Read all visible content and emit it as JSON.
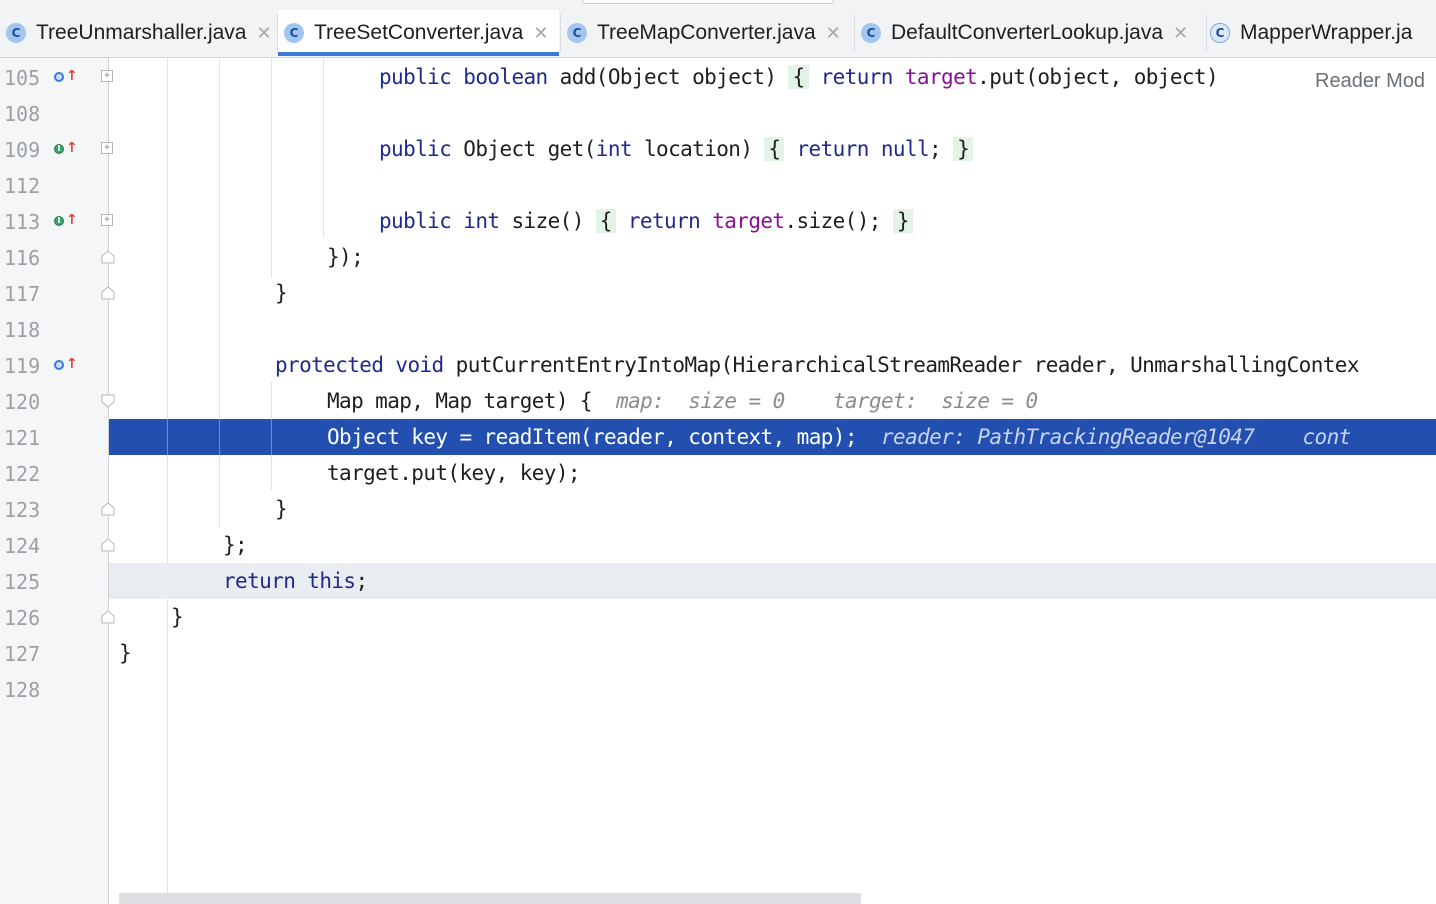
{
  "tabs": [
    {
      "name": "TreeUnmarshaller.java",
      "icon": "class-icon",
      "active": false
    },
    {
      "name": "TreeSetConverter.java",
      "icon": "class-icon",
      "active": true
    },
    {
      "name": "TreeMapConverter.java",
      "icon": "class-icon",
      "active": false
    },
    {
      "name": "DefaultConverterLookup.java",
      "icon": "class-icon",
      "active": false
    },
    {
      "name": "MapperWrapper.ja",
      "icon": "abstract-class-icon",
      "active": false
    }
  ],
  "tab_close_glyph": "✕",
  "reader_mode": "Reader Mod",
  "accent_color": "#3a7cd5",
  "selection_color": "#2350b0",
  "lines": [
    {
      "n": "105",
      "marker": "override",
      "text": "public boolean add(Object object) { return target.put(object, object)"
    },
    {
      "n": "108",
      "text": ""
    },
    {
      "n": "109",
      "marker": "implements",
      "text": "public Object get(int location) { return null; }"
    },
    {
      "n": "112",
      "text": ""
    },
    {
      "n": "113",
      "marker": "implements",
      "text": "public int size() { return target.size(); }"
    },
    {
      "n": "116",
      "text": "});"
    },
    {
      "n": "117",
      "text": "}"
    },
    {
      "n": "118",
      "text": ""
    },
    {
      "n": "119",
      "marker": "override",
      "text": "protected void putCurrentEntryIntoMap(HierarchicalStreamReader reader, UnmarshallingContex"
    },
    {
      "n": "120",
      "text": "Map map, Map target) {",
      "hint": "map:  size = 0    target:  size = 0"
    },
    {
      "n": "121",
      "text": "Object key = readItem(reader, context, map);",
      "hint": "reader: PathTrackingReader@1047    cont",
      "selected": true
    },
    {
      "n": "122",
      "text": "target.put(key, key);"
    },
    {
      "n": "123",
      "text": "}"
    },
    {
      "n": "124",
      "text": "};"
    },
    {
      "n": "125",
      "text": "return this;",
      "current": true
    },
    {
      "n": "126",
      "text": "}"
    },
    {
      "n": "127",
      "text": "}"
    },
    {
      "n": "128",
      "text": ""
    }
  ]
}
